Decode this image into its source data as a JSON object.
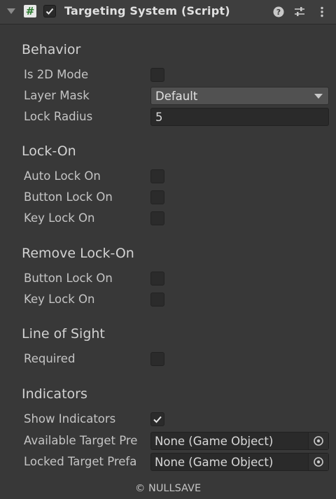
{
  "header": {
    "title": "Targeting System (Script)",
    "enabled": true,
    "icons": [
      "foldout-arrow-icon",
      "script-icon",
      "help-icon",
      "preset-icon",
      "kebab-menu-icon"
    ]
  },
  "sections": {
    "behavior": "Behavior",
    "lock_on": "Lock-On",
    "remove_lock_on": "Remove Lock-On",
    "line_of_sight": "Line of Sight",
    "indicators": "Indicators"
  },
  "fields": {
    "is_2d_mode": {
      "label": "Is 2D Mode",
      "checked": false
    },
    "layer_mask": {
      "label": "Layer Mask",
      "value": "Default"
    },
    "lock_radius": {
      "label": "Lock Radius",
      "value": "5"
    },
    "auto_lock_on": {
      "label": "Auto Lock On",
      "checked": false
    },
    "button_lock_on": {
      "label": "Button Lock On",
      "checked": false
    },
    "key_lock_on": {
      "label": "Key Lock On",
      "checked": false
    },
    "remove_button_lock_on": {
      "label": "Button Lock On",
      "checked": false
    },
    "remove_key_lock_on": {
      "label": "Key Lock On",
      "checked": false
    },
    "required": {
      "label": "Required",
      "checked": false
    },
    "show_indicators": {
      "label": "Show Indicators",
      "checked": true
    },
    "available_target_prefab": {
      "label": "Available Target Pre",
      "value": "None (Game Object)"
    },
    "locked_target_prefab": {
      "label": "Locked Target Prefa",
      "value": "None (Game Object)"
    }
  },
  "footer": {
    "text": "© NULLSAVE"
  },
  "colors": {
    "background": "#383838",
    "header": "#3e3e3e",
    "field": "#2a2a2a",
    "dropdown": "#515151"
  }
}
